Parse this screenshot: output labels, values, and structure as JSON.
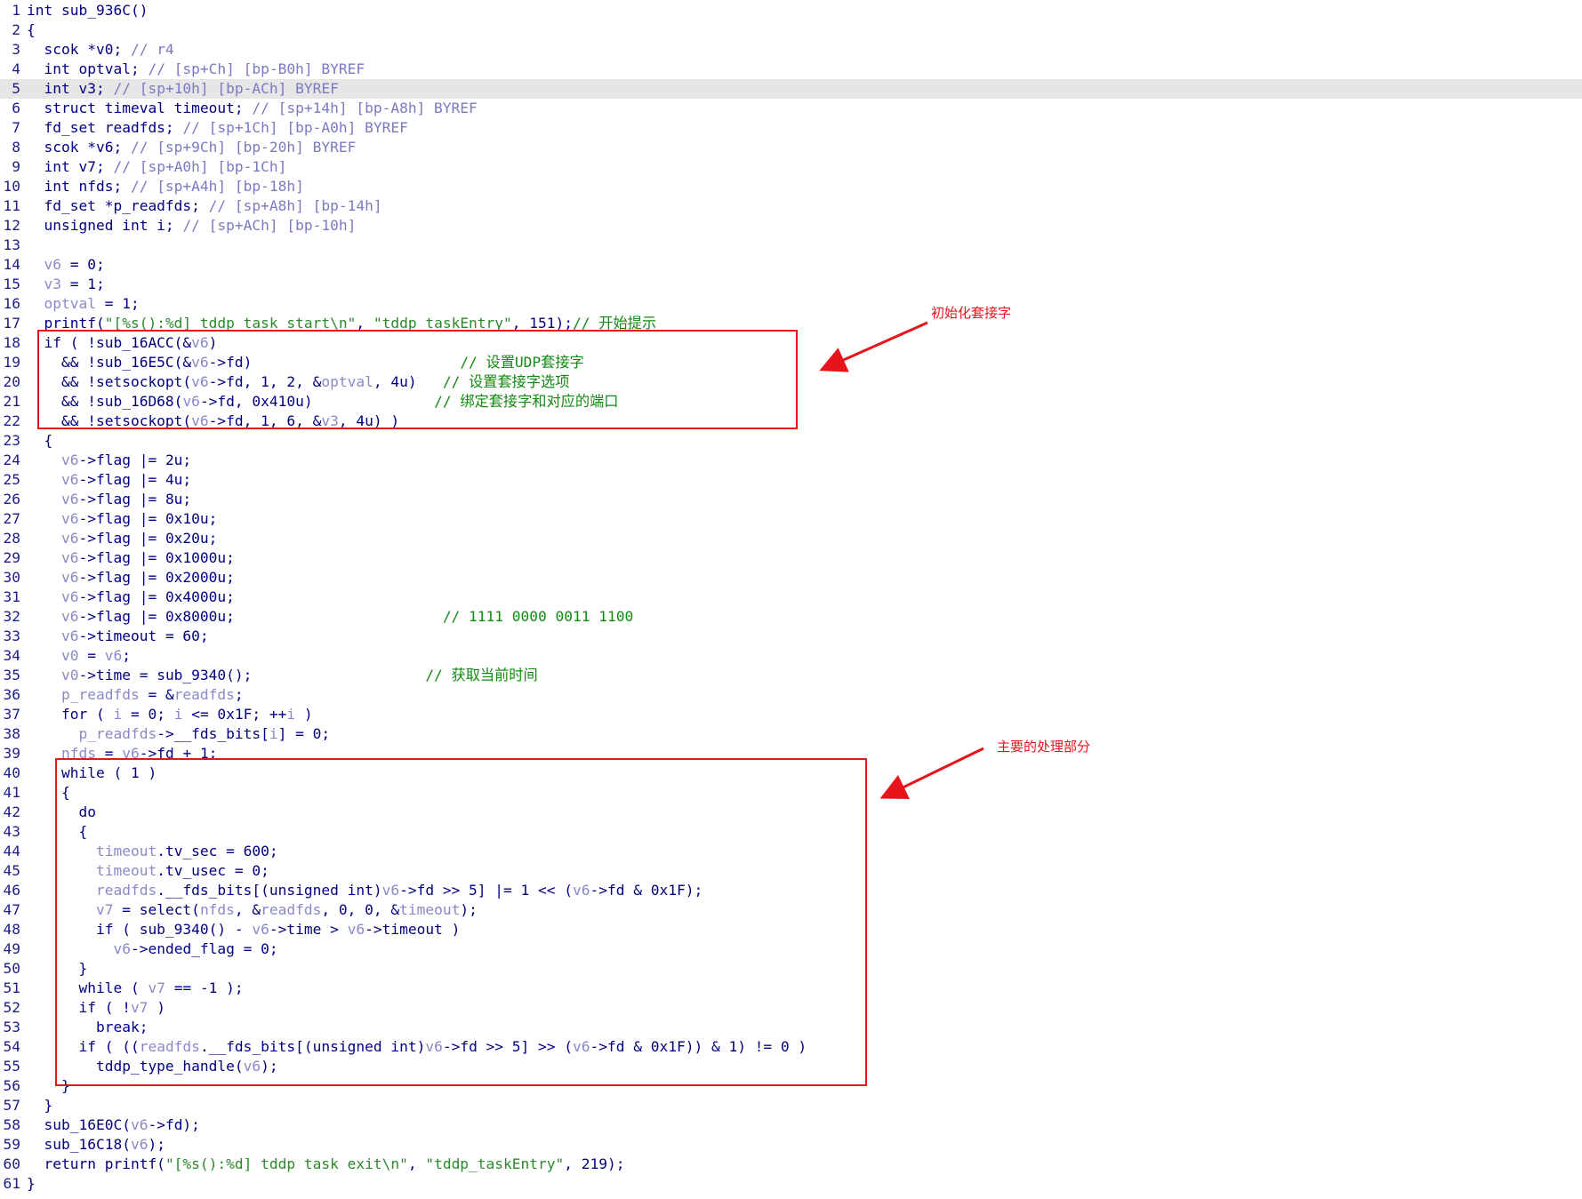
{
  "colors": {
    "annotation": "#e8141c",
    "line_number": "#1c1c8c",
    "code": "#000080",
    "variable": "#8a8ac8",
    "comment": "#7a7ac2",
    "chinese_comment": "#128a12",
    "string": "#2a8a2a",
    "highlight_row": "#e6e6e6"
  },
  "highlighted_line": 5,
  "annotations": {
    "init": "初始化套接字",
    "main": "主要的处理部分"
  },
  "lines": [
    [
      [
        "n",
        "int sub_936C()"
      ]
    ],
    [
      [
        "n",
        "{"
      ]
    ],
    [
      [
        "n",
        "  scok *v0; "
      ],
      [
        "c",
        "// r4"
      ]
    ],
    [
      [
        "n",
        "  int optval; "
      ],
      [
        "c",
        "// [sp+Ch] [bp-B0h] BYREF"
      ]
    ],
    [
      [
        "n",
        "  int v3; "
      ],
      [
        "c",
        "// [sp+10h] [bp-ACh] BYREF"
      ]
    ],
    [
      [
        "n",
        "  struct timeval timeout; "
      ],
      [
        "c",
        "// [sp+14h] [bp-A8h] BYREF"
      ]
    ],
    [
      [
        "n",
        "  fd_set readfds; "
      ],
      [
        "c",
        "// [sp+1Ch] [bp-A0h] BYREF"
      ]
    ],
    [
      [
        "n",
        "  scok *v6; "
      ],
      [
        "c",
        "// [sp+9Ch] [bp-20h] BYREF"
      ]
    ],
    [
      [
        "n",
        "  int v7; "
      ],
      [
        "c",
        "// [sp+A0h] [bp-1Ch]"
      ]
    ],
    [
      [
        "n",
        "  int nfds; "
      ],
      [
        "c",
        "// [sp+A4h] [bp-18h]"
      ]
    ],
    [
      [
        "n",
        "  fd_set *p_readfds; "
      ],
      [
        "c",
        "// [sp+A8h] [bp-14h]"
      ]
    ],
    [
      [
        "n",
        "  unsigned int i; "
      ],
      [
        "c",
        "// [sp+ACh] [bp-10h]"
      ]
    ],
    [
      [
        "n",
        ""
      ]
    ],
    [
      [
        "n",
        "  "
      ],
      [
        "v",
        "v6"
      ],
      [
        "n",
        " = 0;"
      ]
    ],
    [
      [
        "n",
        "  "
      ],
      [
        "v",
        "v3"
      ],
      [
        "n",
        " = 1;"
      ]
    ],
    [
      [
        "n",
        "  "
      ],
      [
        "v",
        "optval"
      ],
      [
        "n",
        " = 1;"
      ]
    ],
    [
      [
        "n",
        "  printf("
      ],
      [
        "s",
        "\"[%s():%d] tddp task start\\n\""
      ],
      [
        "n",
        ", "
      ],
      [
        "s",
        "\"tddp_taskEntry\""
      ],
      [
        "n",
        ", 151);"
      ],
      [
        "z",
        "// 开始提示"
      ]
    ],
    [
      [
        "n",
        "  if ( !sub_16ACC(&"
      ],
      [
        "v",
        "v6"
      ],
      [
        "n",
        ")"
      ]
    ],
    [
      [
        "n",
        "    && !sub_16E5C(&"
      ],
      [
        "v",
        "v6"
      ],
      [
        "n",
        "->fd)                        "
      ],
      [
        "z",
        "// 设置UDP套接字"
      ]
    ],
    [
      [
        "n",
        "    && !setsockopt("
      ],
      [
        "v",
        "v6"
      ],
      [
        "n",
        "->fd, 1, 2, &"
      ],
      [
        "v",
        "optval"
      ],
      [
        "n",
        ", 4u)   "
      ],
      [
        "z",
        "// 设置套接字选项"
      ]
    ],
    [
      [
        "n",
        "    && !sub_16D68("
      ],
      [
        "v",
        "v6"
      ],
      [
        "n",
        "->fd, 0x410u)              "
      ],
      [
        "z",
        "// 绑定套接字和对应的端口"
      ]
    ],
    [
      [
        "n",
        "    && !setsockopt("
      ],
      [
        "v",
        "v6"
      ],
      [
        "n",
        "->fd, 1, 6, &"
      ],
      [
        "v",
        "v3"
      ],
      [
        "n",
        ", 4u) )"
      ]
    ],
    [
      [
        "n",
        "  {"
      ]
    ],
    [
      [
        "n",
        "    "
      ],
      [
        "v",
        "v6"
      ],
      [
        "n",
        "->flag |= 2u;"
      ]
    ],
    [
      [
        "n",
        "    "
      ],
      [
        "v",
        "v6"
      ],
      [
        "n",
        "->flag |= 4u;"
      ]
    ],
    [
      [
        "n",
        "    "
      ],
      [
        "v",
        "v6"
      ],
      [
        "n",
        "->flag |= 8u;"
      ]
    ],
    [
      [
        "n",
        "    "
      ],
      [
        "v",
        "v6"
      ],
      [
        "n",
        "->flag |= 0x10u;"
      ]
    ],
    [
      [
        "n",
        "    "
      ],
      [
        "v",
        "v6"
      ],
      [
        "n",
        "->flag |= 0x20u;"
      ]
    ],
    [
      [
        "n",
        "    "
      ],
      [
        "v",
        "v6"
      ],
      [
        "n",
        "->flag |= 0x1000u;"
      ]
    ],
    [
      [
        "n",
        "    "
      ],
      [
        "v",
        "v6"
      ],
      [
        "n",
        "->flag |= 0x2000u;"
      ]
    ],
    [
      [
        "n",
        "    "
      ],
      [
        "v",
        "v6"
      ],
      [
        "n",
        "->flag |= 0x4000u;"
      ]
    ],
    [
      [
        "n",
        "    "
      ],
      [
        "v",
        "v6"
      ],
      [
        "n",
        "->flag |= 0x8000u;                        "
      ],
      [
        "z",
        "// 1111 0000 0011 1100"
      ]
    ],
    [
      [
        "n",
        "    "
      ],
      [
        "v",
        "v6"
      ],
      [
        "n",
        "->timeout = 60;"
      ]
    ],
    [
      [
        "n",
        "    "
      ],
      [
        "v",
        "v0"
      ],
      [
        "n",
        " = "
      ],
      [
        "v",
        "v6"
      ],
      [
        "n",
        ";"
      ]
    ],
    [
      [
        "n",
        "    "
      ],
      [
        "v",
        "v0"
      ],
      [
        "n",
        "->time = sub_9340();                    "
      ],
      [
        "z",
        "// 获取当前时间"
      ]
    ],
    [
      [
        "n",
        "    "
      ],
      [
        "v",
        "p_readfds"
      ],
      [
        "n",
        " = &"
      ],
      [
        "v",
        "readfds"
      ],
      [
        "n",
        ";"
      ]
    ],
    [
      [
        "n",
        "    for ( "
      ],
      [
        "v",
        "i"
      ],
      [
        "n",
        " = 0; "
      ],
      [
        "v",
        "i"
      ],
      [
        "n",
        " <= 0x1F; ++"
      ],
      [
        "v",
        "i"
      ],
      [
        "n",
        " )"
      ]
    ],
    [
      [
        "n",
        "      "
      ],
      [
        "v",
        "p_readfds"
      ],
      [
        "n",
        "->__fds_bits["
      ],
      [
        "v",
        "i"
      ],
      [
        "n",
        "] = 0;"
      ]
    ],
    [
      [
        "n",
        "    "
      ],
      [
        "v",
        "nfds"
      ],
      [
        "n",
        " = "
      ],
      [
        "v",
        "v6"
      ],
      [
        "n",
        "->fd + 1;"
      ]
    ],
    [
      [
        "n",
        "    while ( 1 )"
      ]
    ],
    [
      [
        "n",
        "    {"
      ]
    ],
    [
      [
        "n",
        "      do"
      ]
    ],
    [
      [
        "n",
        "      {"
      ]
    ],
    [
      [
        "n",
        "        "
      ],
      [
        "v",
        "timeout"
      ],
      [
        "n",
        ".tv_sec = 600;"
      ]
    ],
    [
      [
        "n",
        "        "
      ],
      [
        "v",
        "timeout"
      ],
      [
        "n",
        ".tv_usec = 0;"
      ]
    ],
    [
      [
        "n",
        "        "
      ],
      [
        "v",
        "readfds"
      ],
      [
        "n",
        ".__fds_bits[(unsigned int)"
      ],
      [
        "v",
        "v6"
      ],
      [
        "n",
        "->fd >> 5] |= 1 << ("
      ],
      [
        "v",
        "v6"
      ],
      [
        "n",
        "->fd & 0x1F);"
      ]
    ],
    [
      [
        "n",
        "        "
      ],
      [
        "v",
        "v7"
      ],
      [
        "n",
        " = select("
      ],
      [
        "v",
        "nfds"
      ],
      [
        "n",
        ", &"
      ],
      [
        "v",
        "readfds"
      ],
      [
        "n",
        ", 0, 0, &"
      ],
      [
        "v",
        "timeout"
      ],
      [
        "n",
        ");"
      ]
    ],
    [
      [
        "n",
        "        if ( sub_9340() - "
      ],
      [
        "v",
        "v6"
      ],
      [
        "n",
        "->time > "
      ],
      [
        "v",
        "v6"
      ],
      [
        "n",
        "->timeout )"
      ]
    ],
    [
      [
        "n",
        "          "
      ],
      [
        "v",
        "v6"
      ],
      [
        "n",
        "->ended_flag = 0;"
      ]
    ],
    [
      [
        "n",
        "      }"
      ]
    ],
    [
      [
        "n",
        "      while ( "
      ],
      [
        "v",
        "v7"
      ],
      [
        "n",
        " == -1 );"
      ]
    ],
    [
      [
        "n",
        "      if ( !"
      ],
      [
        "v",
        "v7"
      ],
      [
        "n",
        " )"
      ]
    ],
    [
      [
        "n",
        "        break;"
      ]
    ],
    [
      [
        "n",
        "      if ( (("
      ],
      [
        "v",
        "readfds"
      ],
      [
        "n",
        ".__fds_bits[(unsigned int)"
      ],
      [
        "v",
        "v6"
      ],
      [
        "n",
        "->fd >> 5] >> ("
      ],
      [
        "v",
        "v6"
      ],
      [
        "n",
        "->fd & 0x1F)) & 1) != 0 )"
      ]
    ],
    [
      [
        "n",
        "        tddp_type_handle("
      ],
      [
        "v",
        "v6"
      ],
      [
        "n",
        ");"
      ]
    ],
    [
      [
        "n",
        "    }"
      ]
    ],
    [
      [
        "n",
        "  }"
      ]
    ],
    [
      [
        "n",
        "  sub_16E0C("
      ],
      [
        "v",
        "v6"
      ],
      [
        "n",
        "->fd);"
      ]
    ],
    [
      [
        "n",
        "  sub_16C18("
      ],
      [
        "v",
        "v6"
      ],
      [
        "n",
        ");"
      ]
    ],
    [
      [
        "n",
        "  return printf("
      ],
      [
        "s",
        "\"[%s():%d] tddp task exit\\n\""
      ],
      [
        "n",
        ", "
      ],
      [
        "s",
        "\"tddp_taskEntry\""
      ],
      [
        "n",
        ", 219);"
      ]
    ],
    [
      [
        "n",
        "}"
      ]
    ]
  ]
}
